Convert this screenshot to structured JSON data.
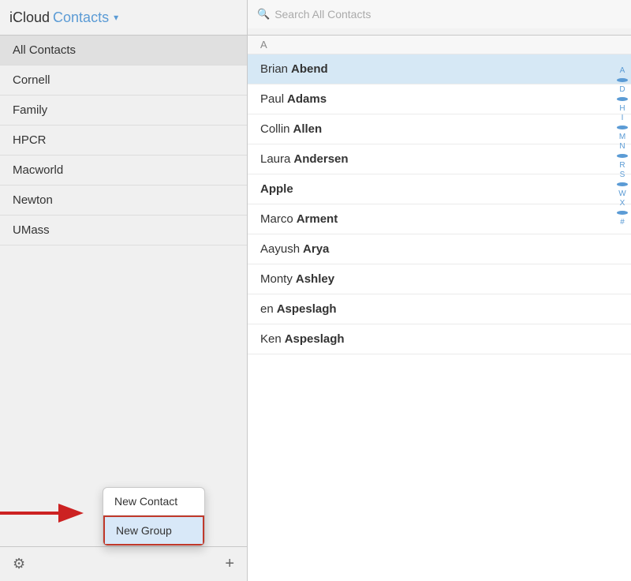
{
  "header": {
    "icloud_label": "iCloud",
    "contacts_label": "Contacts",
    "chevron": "▾"
  },
  "search": {
    "placeholder": "Search All Contacts"
  },
  "sidebar": {
    "items": [
      {
        "label": "All Contacts"
      },
      {
        "label": "Cornell"
      },
      {
        "label": "Family"
      },
      {
        "label": "HPCR"
      },
      {
        "label": "Macworld"
      },
      {
        "label": "Newton"
      },
      {
        "label": "UMass"
      }
    ],
    "footer": {
      "gear_label": "⚙",
      "plus_label": "+"
    }
  },
  "context_menu": {
    "items": [
      {
        "label": "New Contact"
      },
      {
        "label": "New Group"
      }
    ]
  },
  "contacts": {
    "sections": [
      {
        "letter": "A",
        "rows": [
          {
            "first": "Brian",
            "last": "Abend",
            "selected": true
          },
          {
            "first": "Paul",
            "last": "Adams",
            "selected": false
          },
          {
            "first": "Collin",
            "last": "Allen",
            "selected": false
          },
          {
            "first": "Laura",
            "last": "Andersen",
            "selected": false
          },
          {
            "first": "",
            "last": "Apple",
            "selected": false,
            "company": true
          },
          {
            "first": "Marco",
            "last": "Arment",
            "selected": false
          },
          {
            "first": "Aayush",
            "last": "Arya",
            "selected": false
          },
          {
            "first": "Monty",
            "last": "Ashley",
            "selected": false
          },
          {
            "first": "en",
            "last": "Aspeslagh",
            "selected": false,
            "partial": true
          },
          {
            "first": "Ken",
            "last": "Aspeslagh",
            "selected": false
          }
        ]
      }
    ],
    "alpha_index": [
      "A",
      "•",
      "D",
      "•",
      "H",
      "I",
      "•",
      "M",
      "N",
      "•",
      "R",
      "S",
      "•",
      "W",
      "X",
      "•",
      "#"
    ]
  }
}
